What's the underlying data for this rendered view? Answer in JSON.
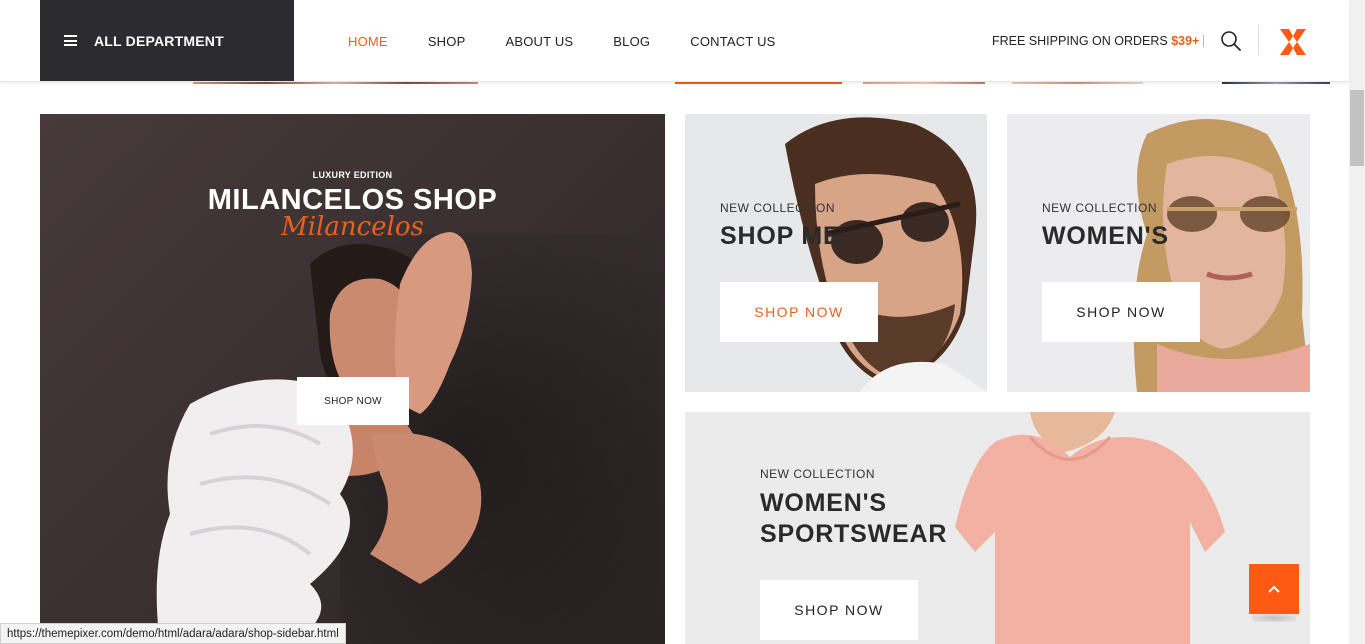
{
  "header": {
    "department_label": "ALL DEPARTMENT",
    "nav": [
      {
        "label": "HOME",
        "active": true
      },
      {
        "label": "SHOP",
        "active": false
      },
      {
        "label": "ABOUT US",
        "active": false
      },
      {
        "label": "BLOG",
        "active": false
      },
      {
        "label": "CONTACT US",
        "active": false
      }
    ],
    "shipping_text": "FREE SHIPPING ON ORDERS ",
    "shipping_amount": "$39+",
    "search_icon": "search-icon",
    "logo_icon": "star-logo-icon"
  },
  "hero": {
    "small": "LUXURY EDITION",
    "title": "MILANCELOS SHOP",
    "script": "Milancelos",
    "button": "SHOP NOW"
  },
  "banners": {
    "men": {
      "subtitle": "NEW COLLECTION",
      "title": "SHOP ME",
      "button": "SHOP NOW"
    },
    "women": {
      "subtitle": "NEW COLLECTION",
      "title": "WOMEN'S",
      "button": "SHOP NOW"
    },
    "sportswear": {
      "subtitle": "NEW COLLECTION",
      "title_line1": "WOMEN'S",
      "title_line2": "SPORTSWEAR",
      "button": "SHOP NOW"
    }
  },
  "back_to_top_icon": "chevron-up-icon",
  "status_url": "https://themepixer.com/demo/html/adara/adara/shop-sidebar.html",
  "colors": {
    "accent": "#e8601c",
    "dark": "#2b2b30"
  }
}
